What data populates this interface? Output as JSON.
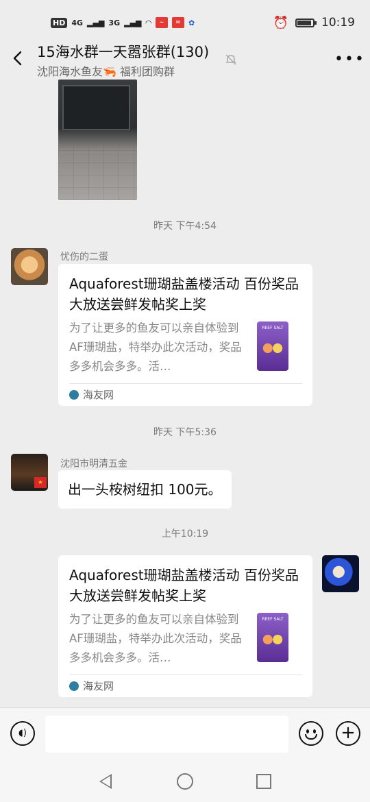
{
  "status_bar": {
    "left_icons": [
      "HD",
      "4G",
      "3G",
      "wifi",
      "app-red",
      "app-red-2",
      "app-blue"
    ],
    "hd": "HD",
    "net1": "4G",
    "net2": "3G",
    "time": "10:19"
  },
  "header": {
    "title": "15海水群一天嚣张群(130)",
    "subtitle": "沈阳海水鱼友🦐 福利团购群"
  },
  "chat": {
    "timestamps": [
      "昨天 下午4:54",
      "昨天 下午5:36",
      "上午10:19"
    ],
    "messages": [
      {
        "sender": "忧伤的二蛋",
        "card": {
          "title": "Aquaforest珊瑚盐盖楼活动 百份奖品大放送尝鲜发帖奖上奖",
          "desc": "为了让更多的鱼友可以亲自体验到AF珊瑚盐，特举办此次活动，奖品多多机会多多。活…",
          "source": "海友网",
          "thumb_label": "REEF SALT"
        }
      },
      {
        "sender": "沈阳市明清五金",
        "text": "出一头桉树纽扣 100元。"
      },
      {
        "sender": "",
        "card": {
          "title": "Aquaforest珊瑚盐盖楼活动 百份奖品大放送尝鲜发帖奖上奖",
          "desc": "为了让更多的鱼友可以亲自体验到AF珊瑚盐，特举办此次活动，奖品多多机会多多。活…",
          "source": "海友网",
          "thumb_label": "REEF SALT"
        }
      }
    ]
  },
  "input": {
    "placeholder": ""
  }
}
